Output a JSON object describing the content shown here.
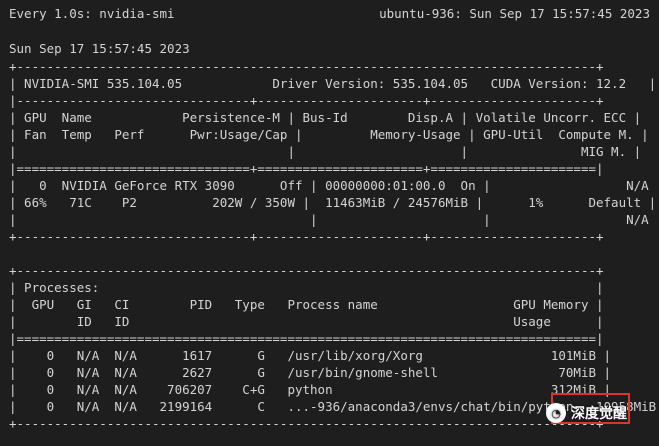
{
  "header": {
    "watch_command": "Every 1.0s: nvidia-smi",
    "host_time": "ubuntu-936: Sun Sep 17 15:57:45 2023",
    "date_line": "Sun Sep 17 15:57:45 2023"
  },
  "table": {
    "border_top": "+-----------------------------------------------------------------------------+",
    "version_row": "| NVIDIA-SMI 535.104.05            Driver Version: 535.104.05   CUDA Version: 12.2   |",
    "sep_dash": "|-------------------------------+----------------------+----------------------+",
    "hdr1": "| GPU  Name            Persistence-M | Bus-Id        Disp.A | Volatile Uncorr. ECC |",
    "hdr2": "| Fan  Temp   Perf      Pwr:Usage/Cap |         Memory-Usage | GPU-Util  Compute M. |",
    "hdr3": "|                                    |                      |               MIG M. |",
    "sep_eq": "|===============================+======================+======================|",
    "gpu1": "|   0  NVIDIA GeForce RTX 3090      Off | 00000000:01:00.0  On |                  N/A |",
    "gpu2": "| 66%   71C    P2          202W / 350W |  11463MiB / 24576MiB |      1%      Default |",
    "gpu3": "|                                       |                      |                  N/A |",
    "border_bottom": "+-------------------------------+----------------------+----------------------+"
  },
  "processes": {
    "border_top": "+-----------------------------------------------------------------------------+",
    "title": "| Processes:                                                                  |",
    "hdr1": "|  GPU   GI   CI        PID   Type   Process name                  GPU Memory |",
    "hdr2": "|        ID   ID                                                   Usage      |",
    "sep_eq": "|=============================================================================|",
    "rows": [
      "|    0   N/A  N/A      1617      G   /usr/lib/xorg/Xorg                 101MiB |",
      "|    0   N/A  N/A      2627      G   /usr/bin/gnome-shell                70MiB |",
      "|    0   N/A  N/A    706207    C+G   python                             312MiB |",
      "|    0   N/A  N/A   2199164      C   ...-936/anaconda3/envs/chat/bin/python   10958MiB |"
    ],
    "border_bottom": "+-----------------------------------------------------------------------------+"
  },
  "watermark": {
    "text": "深度觉醒",
    "icon": "wechat-icon",
    "icon_glyph": "◔"
  },
  "colors": {
    "background": "#1e1e1e",
    "text": "#d4d4d4",
    "highlight": "#e0322c"
  }
}
